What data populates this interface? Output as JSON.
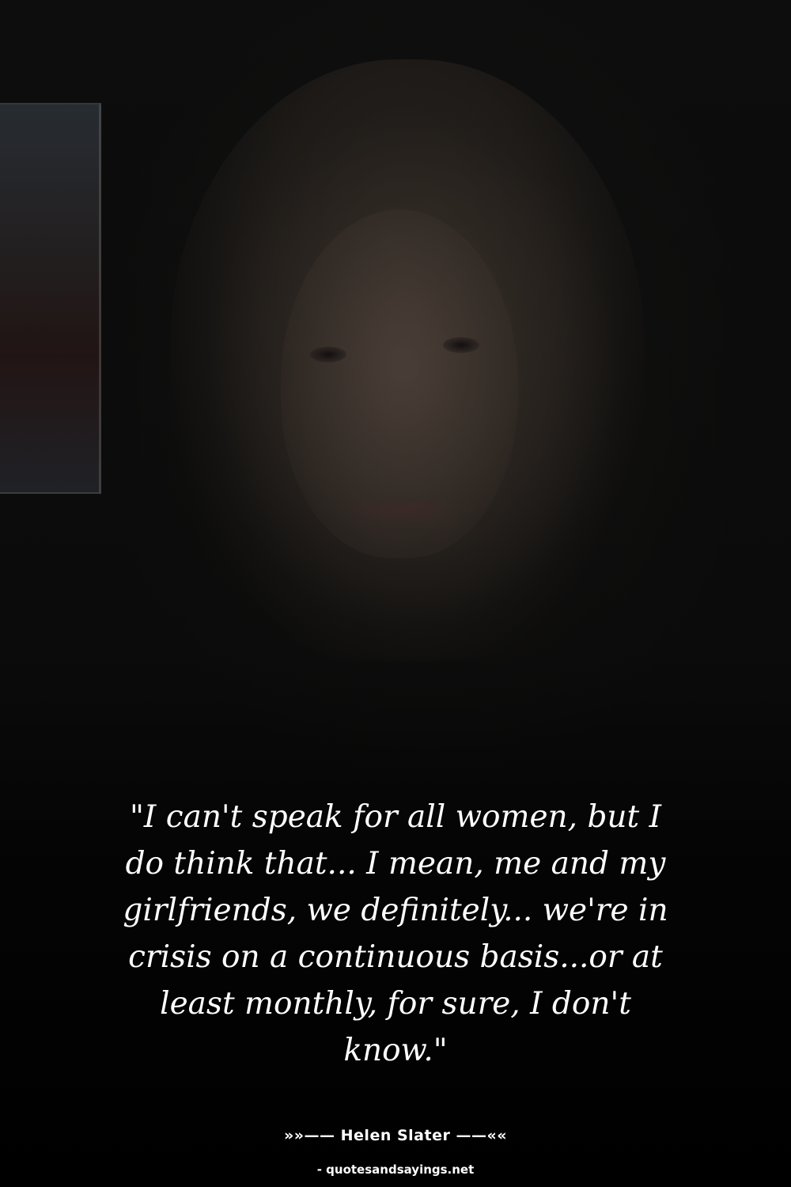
{
  "background": {
    "description_icon": "portrait-photo",
    "overlay_color": "#000000"
  },
  "quote": {
    "text": "\"I can't speak for all women, but I do think that... I mean, me and my girlfriends, we definitely... we're in crisis on a continuous basis...or at least monthly, for sure, I don't know.\""
  },
  "author": {
    "line": "»»—— Helen Slater ——««"
  },
  "source": {
    "text": "- quotesandsayings.net"
  },
  "colors": {
    "text": "#ffffff",
    "background": "#000000"
  }
}
